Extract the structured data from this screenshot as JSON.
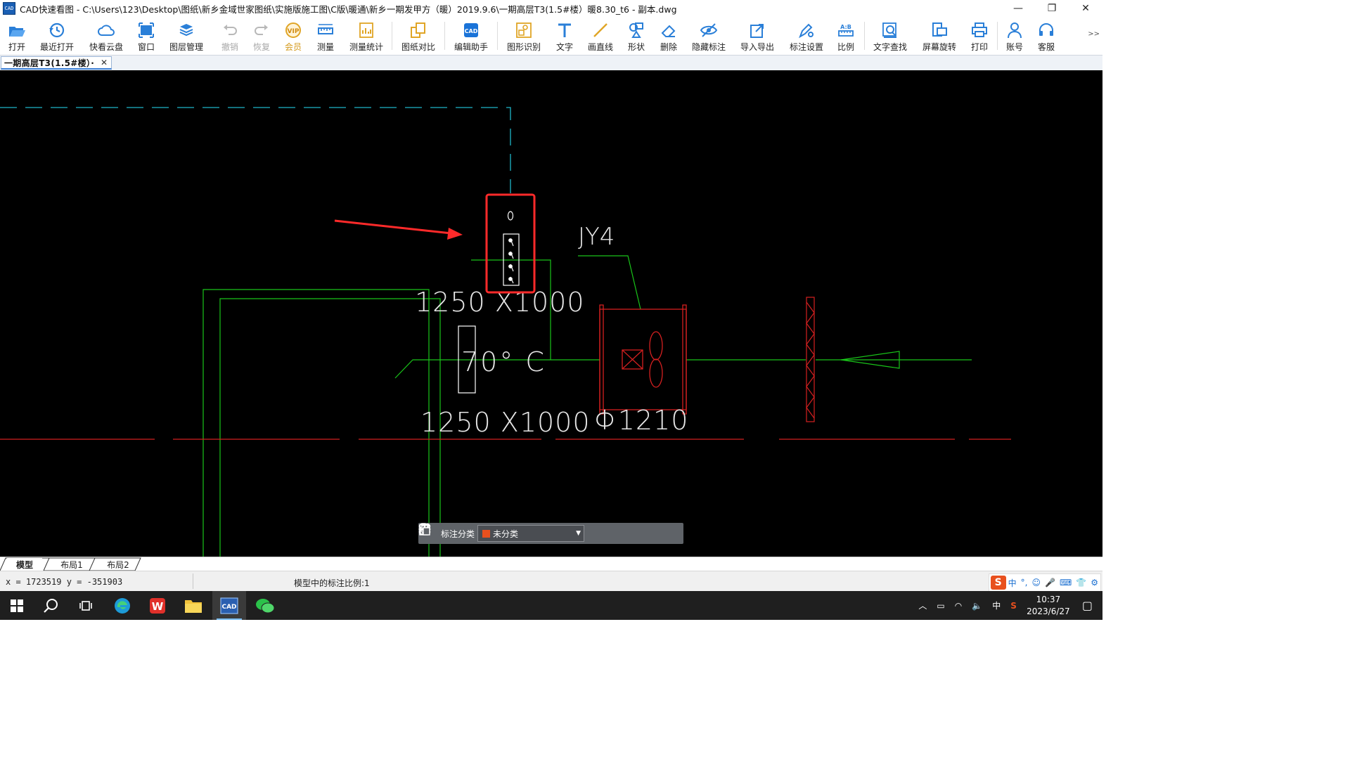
{
  "window": {
    "app_icon": "CAD",
    "title": "CAD快速看图 - C:\\Users\\123\\Desktop\\图纸\\新乡金域世家图纸\\实施版施工图\\C版\\暖通\\新乡一期发甲方（暖）2019.9.6\\一期高层T3(1.5#楼）暖8.30_t6 - 副本.dwg",
    "controls": {
      "minimize": "—",
      "restore": "❐",
      "close": "✕"
    }
  },
  "toolbar": {
    "open": "打开",
    "recent": "最近打开",
    "cloud": "快看云盘",
    "window": "窗口",
    "layers": "图层管理",
    "undo": "撤销",
    "redo": "恢复",
    "vip": "会员",
    "measure": "测量",
    "measure_stats": "测量统计",
    "compare": "图纸对比",
    "edit_helper": "编辑助手",
    "recognize": "图形识别",
    "text": "文字",
    "line": "画直线",
    "shape": "形状",
    "delete": "删除",
    "hide_annot": "隐藏标注",
    "import_export": "导入导出",
    "annot_settings": "标注设置",
    "ratio": "比例",
    "text_search": "文字查找",
    "rotate": "屏幕旋转",
    "print": "打印",
    "account": "账号",
    "service": "客服",
    "more": ">>"
  },
  "doc_tab": {
    "label": "一期高层T3(1.5#楼）·",
    "close": "✕"
  },
  "drawing": {
    "labels": {
      "jy4": "JY4",
      "duct_upper": "1250 X1000",
      "temp": "70° C",
      "duct_lower": "1250 X1000",
      "fan_dia": "Φ1210"
    }
  },
  "annotation_bar": {
    "label": "标注分类",
    "value": "未分类",
    "swatch_color": "#e8501e"
  },
  "layout_tabs": [
    "模型",
    "布局1",
    "布局2"
  ],
  "status": {
    "coords": "x = 1723519  y = -351903",
    "scale": "模型中的标注比例:1",
    "ime": [
      "中",
      "°,",
      "☺",
      "🎤",
      "⌨",
      "👕",
      "⚙"
    ]
  },
  "taskbar": {
    "tray_lang": "中",
    "time": "10:37",
    "date": "2023/6/27"
  }
}
